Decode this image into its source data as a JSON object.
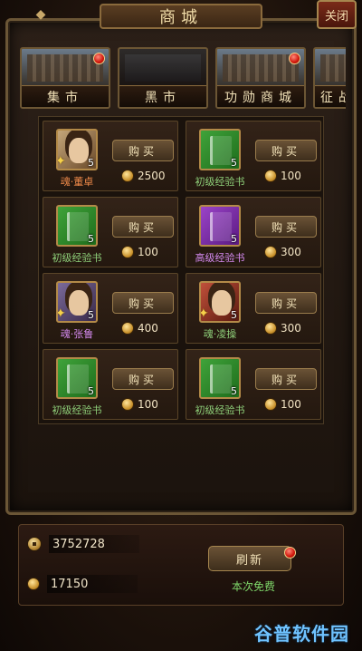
{
  "header": {
    "title": "商城",
    "close_label": "关闭"
  },
  "tabs": [
    {
      "label": "集市",
      "badge": true
    },
    {
      "label": "黑市",
      "badge": false
    },
    {
      "label": "功勋商城",
      "badge": true
    },
    {
      "label": "征战",
      "badge": false
    }
  ],
  "items": [
    {
      "name": "魂·董卓",
      "count": "5",
      "price": "2500",
      "buy_label": "购买",
      "type": "portrait",
      "name_color": "orange",
      "star": true
    },
    {
      "name": "初级经验书",
      "count": "5",
      "price": "100",
      "buy_label": "购买",
      "type": "green-book",
      "name_color": "green",
      "star": false
    },
    {
      "name": "初级经验书",
      "count": "5",
      "price": "100",
      "buy_label": "购买",
      "type": "green-book",
      "name_color": "green",
      "star": false
    },
    {
      "name": "高级经验书",
      "count": "5",
      "price": "300",
      "buy_label": "购买",
      "type": "purple-book",
      "name_color": "purple",
      "star": false
    },
    {
      "name": "魂·张鲁",
      "count": "5",
      "price": "400",
      "buy_label": "购买",
      "type": "portrait",
      "name_color": "purple",
      "star": true
    },
    {
      "name": "魂·凌操",
      "count": "5",
      "price": "300",
      "buy_label": "购买",
      "type": "portrait",
      "name_color": "green",
      "star": true
    },
    {
      "name": "初级经验书",
      "count": "5",
      "price": "100",
      "buy_label": "购买",
      "type": "green-book",
      "name_color": "green",
      "star": false
    },
    {
      "name": "初级经验书",
      "count": "5",
      "price": "100",
      "buy_label": "购买",
      "type": "green-book",
      "name_color": "green",
      "star": false
    }
  ],
  "footer": {
    "coins": "3752728",
    "gold": "17150",
    "refresh_label": "刷新",
    "refresh_badge": true,
    "free_text": "本次免费"
  },
  "watermark": "谷普软件园",
  "colors": {
    "accent_gold": "#b38a48",
    "badge_red": "#d0150a",
    "free_green": "#7fd86a"
  }
}
